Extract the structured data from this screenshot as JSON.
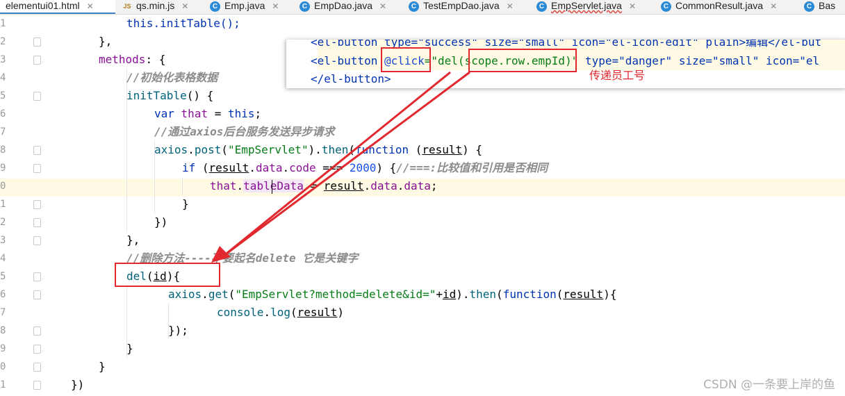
{
  "tabs": [
    {
      "name": "elementui01.html",
      "icon": "html-file-icon",
      "active": true
    },
    {
      "name": "qs.min.js",
      "icon": "js-file-icon",
      "active": false
    },
    {
      "name": "Emp.java",
      "icon": "java-class-icon",
      "active": false
    },
    {
      "name": "EmpDao.java",
      "icon": "java-class-icon",
      "active": false
    },
    {
      "name": "TestEmpDao.java",
      "icon": "java-class-icon",
      "active": false
    },
    {
      "name": "EmpServlet.java",
      "icon": "java-class-icon",
      "active": false
    },
    {
      "name": "CommonResult.java",
      "icon": "java-class-icon",
      "active": false
    },
    {
      "name": "Bas",
      "icon": "java-class-icon",
      "active": false
    }
  ],
  "line_numbers": [
    "1",
    "2",
    "3",
    "4",
    "5",
    "6",
    "7",
    "8",
    "9",
    "0",
    "1",
    "2",
    "3",
    "4",
    "5",
    "6",
    "7",
    "8",
    "9",
    "0",
    "1"
  ],
  "code": {
    "l1": "this.initTable();",
    "l2": "},",
    "l3_key": "methods",
    "l3_rest": ": {",
    "l4_comment": "//初始化表格数据",
    "l5_fn": "initTable",
    "l5_rest": "() {",
    "l6_var": "var",
    "l6_name": "that",
    "l6_eq": " = ",
    "l6_this": "this",
    "l6_end": ";",
    "l7_comment": "//通过axios后台服务发送异步请求",
    "l8_axios": "axios",
    "l8_post": "post",
    "l8_str": "\"EmpServlet\"",
    "l8_then": "then",
    "l8_function": "function",
    "l8_result": "result",
    "l9_if": "if",
    "l9_result": "result",
    "l9_data": "data",
    "l9_code": "code",
    "l9_op": " === ",
    "l9_num": "2000",
    "l9_brace": ") {",
    "l9_comment": "//===:比较值和引用是否相同",
    "l10_that": "that",
    "l10_prop": "tableData",
    "l10_eq": " = ",
    "l10_result": "result",
    "l10_data1": "data",
    "l10_data2": "data",
    "l11": "}",
    "l12": "})",
    "l13": "},",
    "l14_comment": "//删除方法----不要起名delete 它是关键字",
    "l15_fn": "del",
    "l15_id": "id",
    "l15_end": "){",
    "l16_axios": "axios",
    "l16_get": "get",
    "l16_str": "\"EmpServlet?method=delete&id=\"",
    "l16_plus": "+",
    "l16_id": "id",
    "l16_then": "then",
    "l16_function": "function",
    "l16_result": "result",
    "l16_end": "){",
    "l17_console": "console",
    "l17_log": "log",
    "l17_result": "result",
    "l18": "});",
    "l19": "}",
    "l20": "}",
    "l21": "})"
  },
  "popup": {
    "line1": "<el-button type=\"success\" size=\"small\" icon=\"el-icon-edit\" plain>编辑</el-but",
    "line2_tag": "<el-button",
    "line2_click": "@click",
    "line2_eq": "=\"del(",
    "line2_scope": "scope.row.empId",
    "line2_close": ")\"",
    "line2_rest": " type=\"danger\" size=\"small\" icon=\"el",
    "line3": "</el-button>"
  },
  "annotation": "传递员工号",
  "watermark": "CSDN @一条要上岸的鱼",
  "colors": {
    "highlight": "#e0282e",
    "keyword": "#0033b3",
    "string": "#067d17"
  }
}
